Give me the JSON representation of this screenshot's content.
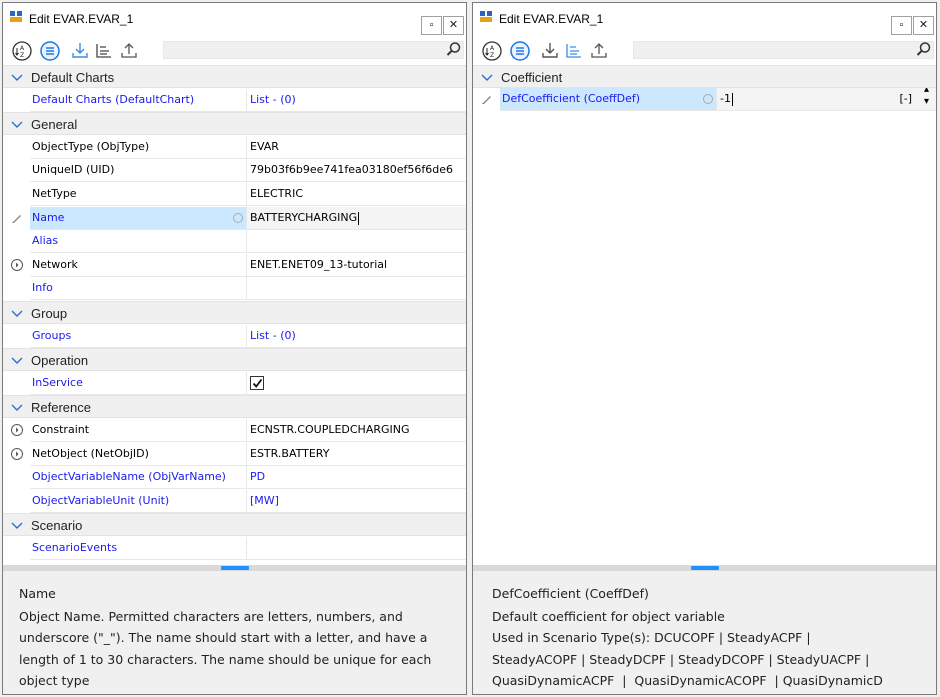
{
  "left": {
    "title": "Edit EVAR.EVAR_1",
    "maximize_glyph": "▫",
    "close_glyph": "✕",
    "toolbar_icons": [
      "sort-alphabetical-icon",
      "categorized-icon",
      "import-icon",
      "tree-view-icon",
      "export-icon",
      "search-icon"
    ],
    "search_value": "",
    "categories": [
      {
        "label": "Default Charts",
        "rows": [
          {
            "name": "Default Charts (DefaultChart)",
            "value": "List - (0)",
            "blue_name": true,
            "blue_value": true
          }
        ]
      },
      {
        "label": "General",
        "rows": [
          {
            "name": "ObjectType (ObjType)",
            "value": "EVAR"
          },
          {
            "name": "UniqueID (UID)",
            "value": "79b03f6b9ee741fea03180ef56f6de6"
          },
          {
            "name": "NetType",
            "value": "ELECTRIC"
          },
          {
            "name": "Name",
            "value": "BATTERYCHARGING",
            "blue_name": true,
            "selected": true,
            "editing": true
          },
          {
            "name": "Alias",
            "value": "",
            "blue_name": true
          },
          {
            "name": "Network",
            "value": "ENET.ENET09_13-tutorial",
            "expandable": true
          },
          {
            "name": "Info",
            "value": "",
            "blue_name": true
          }
        ]
      },
      {
        "label": "Group",
        "rows": [
          {
            "name": "Groups",
            "value": "List - (0)",
            "blue_name": true,
            "blue_value": true
          }
        ]
      },
      {
        "label": "Operation",
        "rows": [
          {
            "name": "InService",
            "value": "",
            "blue_name": true,
            "checked": true
          }
        ]
      },
      {
        "label": "Reference",
        "rows": [
          {
            "name": "Constraint",
            "value": "ECNSTR.COUPLEDCHARGING",
            "expandable": true
          },
          {
            "name": "NetObject (NetObjID)",
            "value": "ESTR.BATTERY",
            "expandable": true
          },
          {
            "name": "ObjectVariableName (ObjVarName)",
            "value": "PD",
            "blue_name": true,
            "blue_value": true
          },
          {
            "name": "ObjectVariableUnit (Unit)",
            "value": "[MW]",
            "blue_name": true,
            "blue_value": true
          }
        ]
      },
      {
        "label": "Scenario",
        "rows": [
          {
            "name": "ScenarioEvents",
            "value": "",
            "blue_name": true
          }
        ]
      }
    ],
    "desc_title": "Name",
    "desc_body": "Object Name. Permitted characters are letters, numbers, and underscore (\"_\"). The name should start with a letter, and have a length of 1 to 30 characters. The name should be unique for each object type"
  },
  "right": {
    "title": "Edit EVAR.EVAR_1",
    "maximize_glyph": "▫",
    "close_glyph": "✕",
    "search_value": "",
    "category": "Coefficient",
    "row_name": "DefCoefficient (CoeffDef)",
    "row_value": "-1",
    "row_unit": "[-]",
    "spinner_up": "▴",
    "spinner_down": "▾",
    "desc_title": "DefCoefficient (CoeffDef)",
    "desc_line1": "Default coefficient for object variable",
    "desc_line2": "Used in Scenario Type(s): DCUCOPF | SteadyACPF |",
    "desc_line3": "SteadyACOPF | SteadyDCPF | SteadyDCOPF | SteadyUACPF |",
    "desc_line4": "QuasiDynamicACPF  |  QuasiDynamicACOPF  | QuasiDynamicD"
  }
}
